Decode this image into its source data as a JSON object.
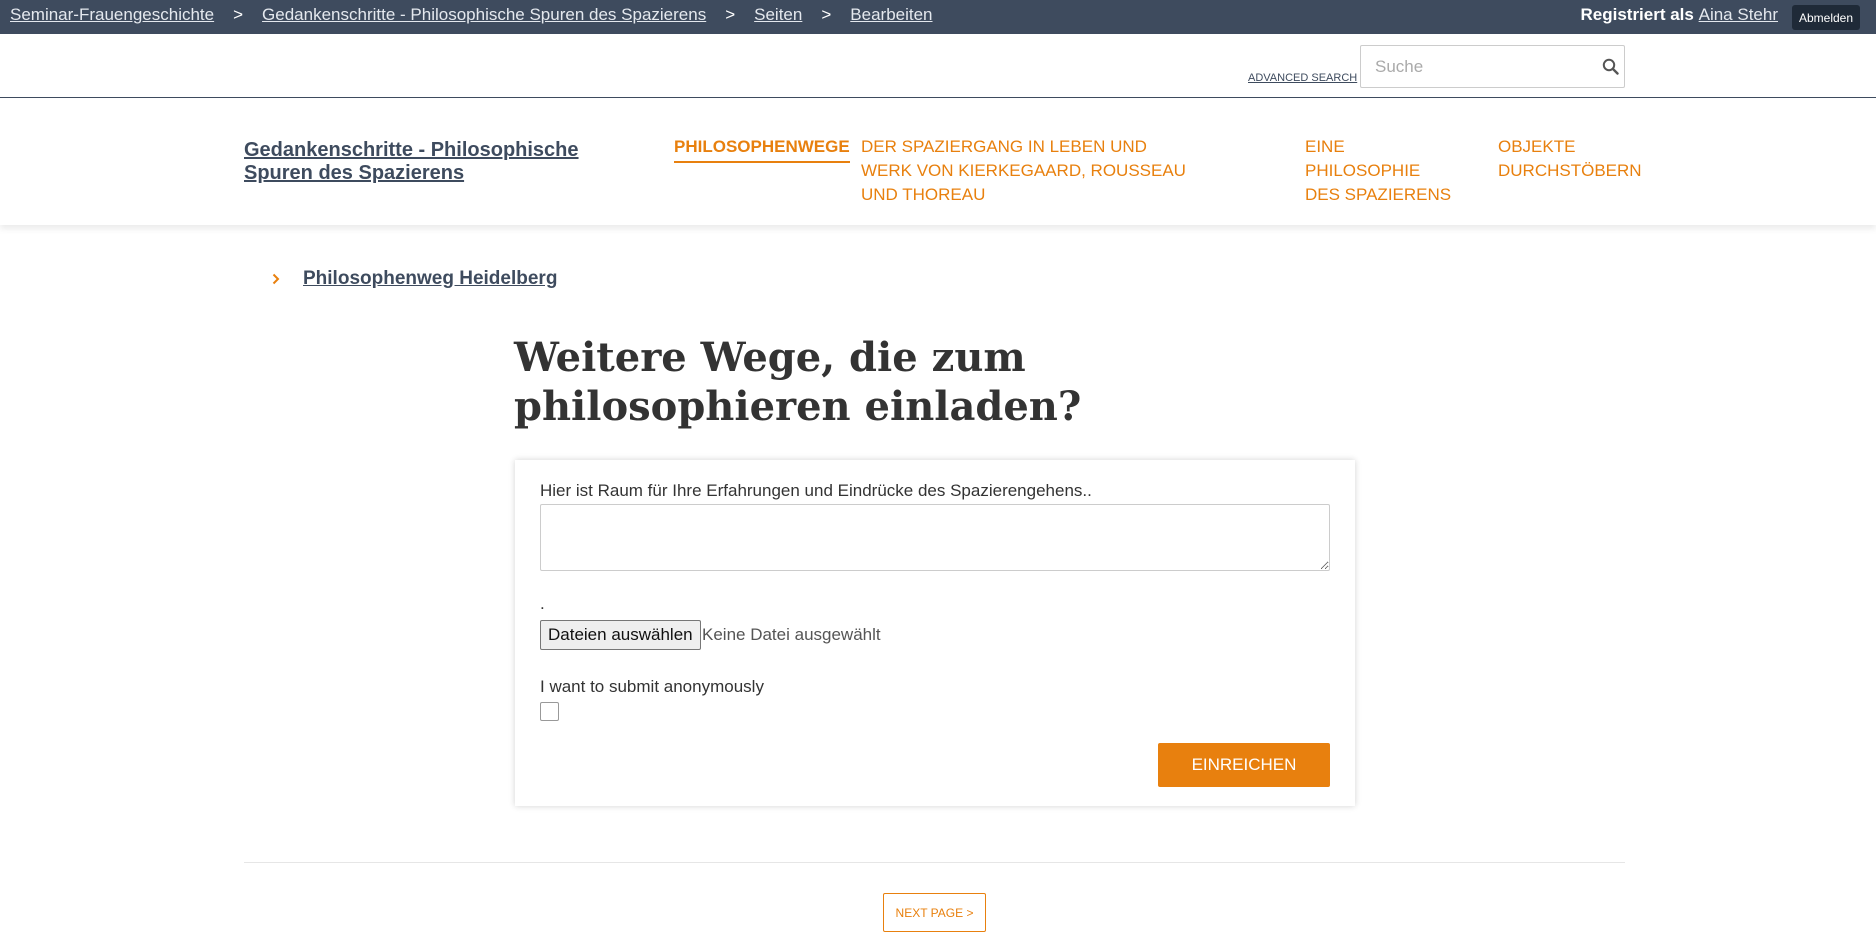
{
  "admin_bar": {
    "breadcrumbs": [
      "Seminar-Frauengeschichte",
      "Gedankenschritte - Philosophische Spuren des Spazierens",
      "Seiten",
      "Bearbeiten"
    ],
    "separator": ">",
    "registered_as": "Registriert als",
    "user_name": "Aina Stehr",
    "logout_label": "Abmelden"
  },
  "search": {
    "advanced_label": "ADVANCED SEARCH",
    "placeholder": "Suche",
    "icon": "search-icon"
  },
  "header": {
    "site_title": "Gedankenschritte - Philosophische Spuren des Spazierens",
    "nav": [
      {
        "label": "PHILOSOPHENWEGE",
        "active": true
      },
      {
        "label": "DER SPAZIERGANG IN LEBEN UND WERK VON KIERKEGAARD, ROUSSEAU UND THOREAU",
        "active": false
      },
      {
        "label": "EINE PHILOSOPHIE DES SPAZIERENS",
        "active": false
      },
      {
        "label": "OBJEKTE DURCHSTÖBERN",
        "active": false
      }
    ]
  },
  "subnav": {
    "link_label": "Philosophenweg Heidelberg",
    "icon": "chevron-right-icon"
  },
  "page": {
    "title": "Weitere Wege, die zum philosophieren einladen?"
  },
  "form": {
    "textarea_label": "Hier ist Raum für Ihre Erfahrungen und Eindrücke des Spazierengehens..",
    "textarea_value": "",
    "file_label": ".",
    "file_button": "Dateien auswählen",
    "file_status": "Keine Datei ausgewählt",
    "anonymous_label": "I want to submit anonymously",
    "anonymous_checked": false,
    "submit_label": "EINREICHEN"
  },
  "pager": {
    "next_label": "NEXT PAGE >"
  },
  "colors": {
    "admin_bar": "#3e4b5e",
    "accent": "#e8800e",
    "link": "#3e4b5e"
  }
}
